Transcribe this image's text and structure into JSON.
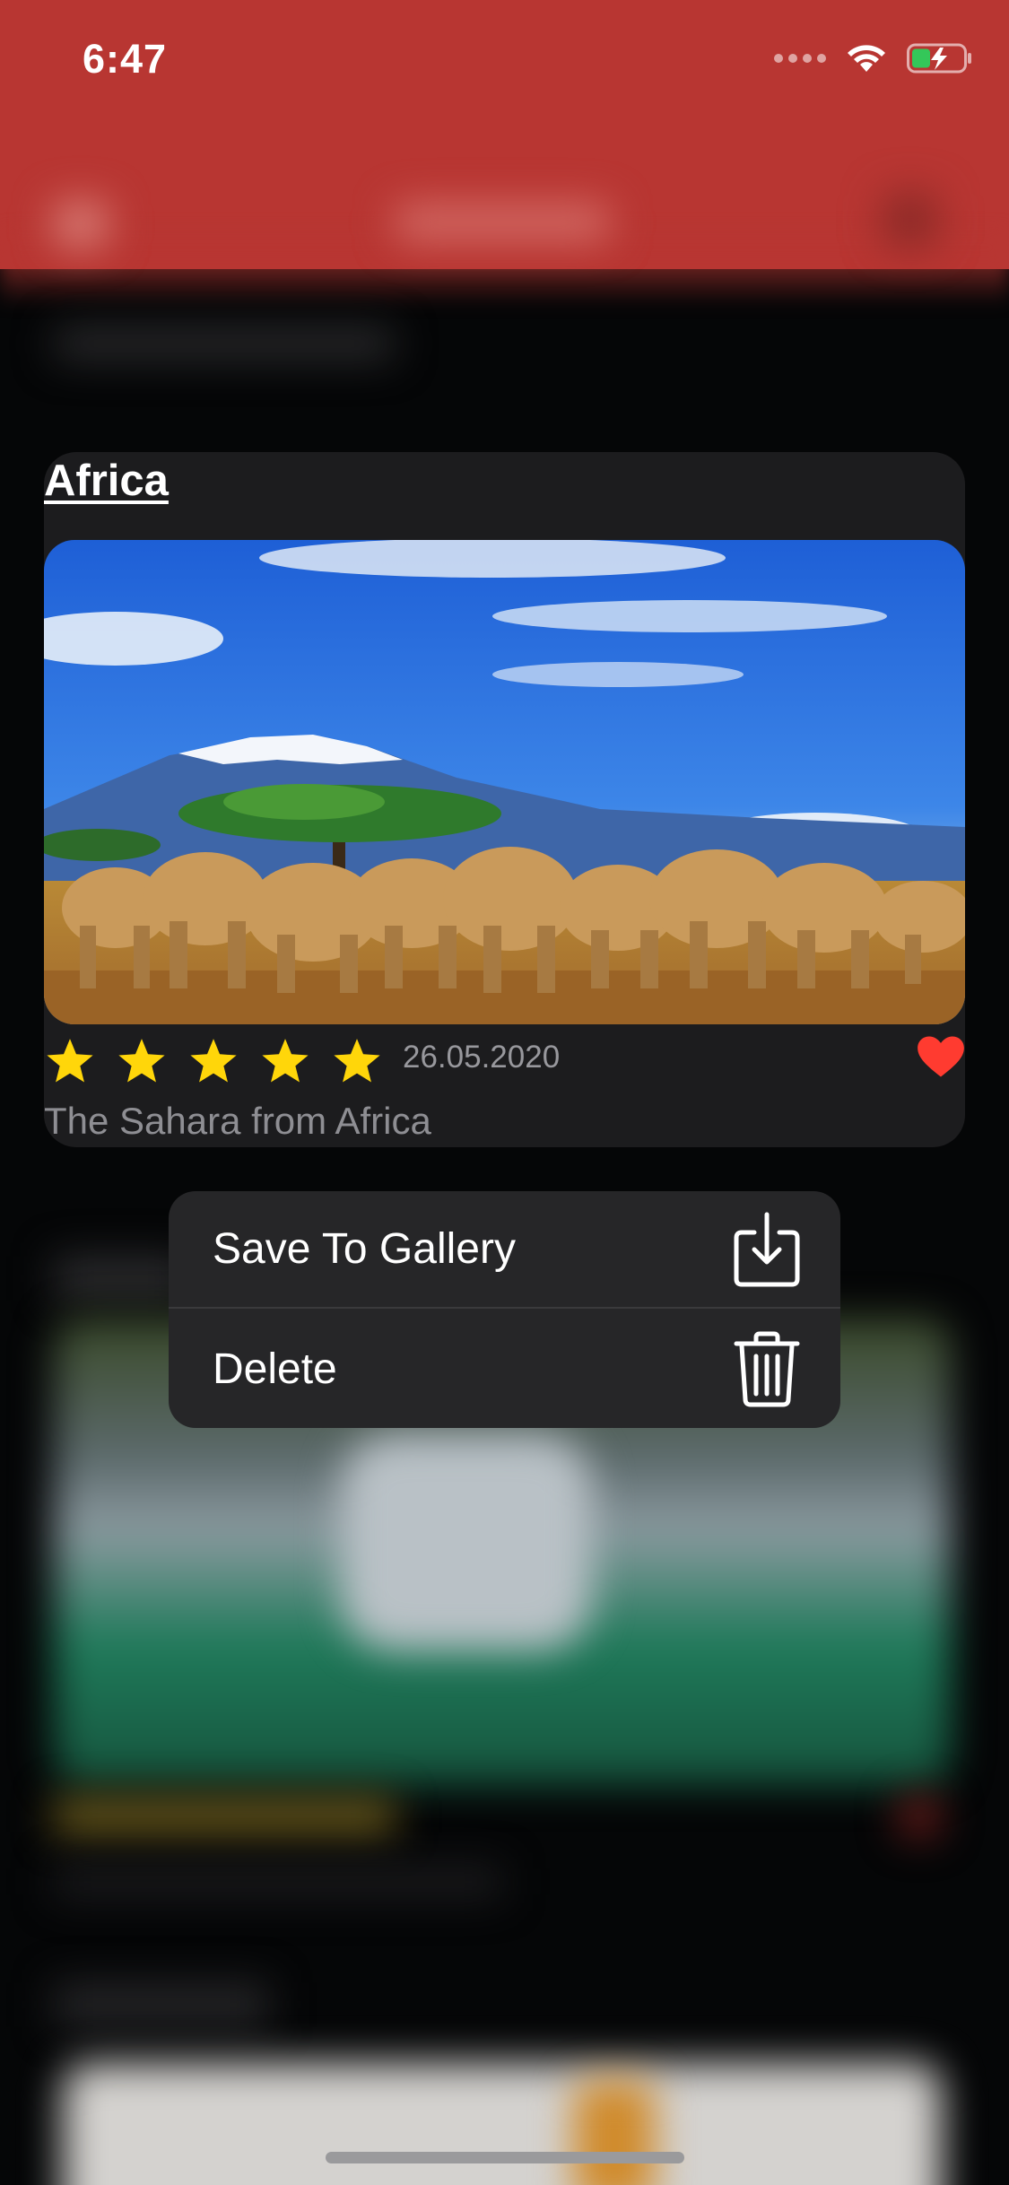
{
  "status_bar": {
    "time": "6:47"
  },
  "card": {
    "title": "Africa",
    "rating": 5,
    "date": "26.05.2020",
    "caption": "The Sahara from Africa",
    "favorite": true
  },
  "context_menu": {
    "items": [
      {
        "label": "Save To Gallery",
        "icon": "save-to-gallery-icon"
      },
      {
        "label": "Delete",
        "icon": "trash-icon"
      }
    ]
  },
  "colors": {
    "navbar": "#b83632",
    "star": "#ffd60a",
    "heart": "#ff3b30",
    "card": "#1c1c1e",
    "menu": "#262628"
  }
}
